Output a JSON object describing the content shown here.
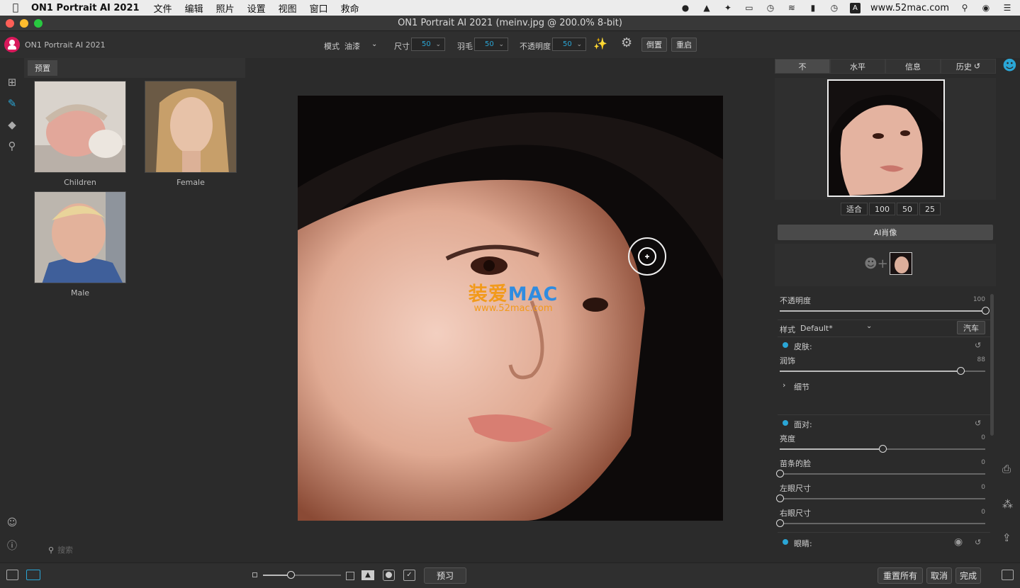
{
  "menubar": {
    "app_name": "ON1 Portrait AI 2021",
    "items": [
      "文件",
      "编辑",
      "照片",
      "设置",
      "视图",
      "窗口",
      "救命"
    ],
    "site": "www.52mac.com",
    "input_badge": "A"
  },
  "window": {
    "title": "ON1 Portrait AI 2021 (meinv.jpg @ 200.0% 8-bit)"
  },
  "toolbar": {
    "app_label": "ON1 Portrait AI 2021",
    "mode_label": "模式",
    "mode_value": "油漆",
    "size_label": "尺寸",
    "size_value": "50",
    "feather_label": "羽毛",
    "feather_value": "50",
    "opacity_label": "不透明度",
    "opacity_value": "50",
    "invert_button": "倒置",
    "reset_button": "重启"
  },
  "presets": {
    "tab_label": "预置",
    "items": [
      {
        "label": "Children"
      },
      {
        "label": "Female"
      },
      {
        "label": "Male"
      }
    ],
    "search_placeholder": "搜索"
  },
  "watermark": {
    "brand_cn": "装爱",
    "brand_en": "MAC",
    "url": "www.52mac.com"
  },
  "right_panel": {
    "tabs": [
      "不",
      "水平",
      "信息",
      "历史"
    ],
    "zoom_options": [
      "适合",
      "100",
      "50",
      "25"
    ],
    "ai_header": "AI肖像",
    "opacity_label": "不透明度",
    "opacity_value": "100",
    "opacity_level": 1.0,
    "style_label": "样式",
    "style_value": "Default*",
    "car_button": "汽车",
    "skin_section": "皮肤:",
    "smooth_label": "润饰",
    "smooth_value": "88",
    "smooth_level": 0.88,
    "detail_label": "细节",
    "face_section": "面对:",
    "brightness_label": "亮度",
    "brightness_value": "0",
    "brightness_level": 0.5,
    "slim_label": "苗条的脸",
    "slim_value": "0",
    "slim_level": 0.0,
    "left_eye_label": "左眼尺寸",
    "left_eye_value": "0",
    "left_eye_level": 0.0,
    "right_eye_label": "右眼尺寸",
    "right_eye_value": "0",
    "right_eye_level": 0.0,
    "eyes_section": "眼睛:"
  },
  "bottom": {
    "preview_button": "预习",
    "reset_all_button": "重置所有",
    "cancel_button": "取消",
    "done_button": "完成",
    "zoom_level": 0.35
  },
  "colors": {
    "accent": "#2aa6d6",
    "logo": "#d9195b",
    "bg": "#2b2b2b"
  }
}
